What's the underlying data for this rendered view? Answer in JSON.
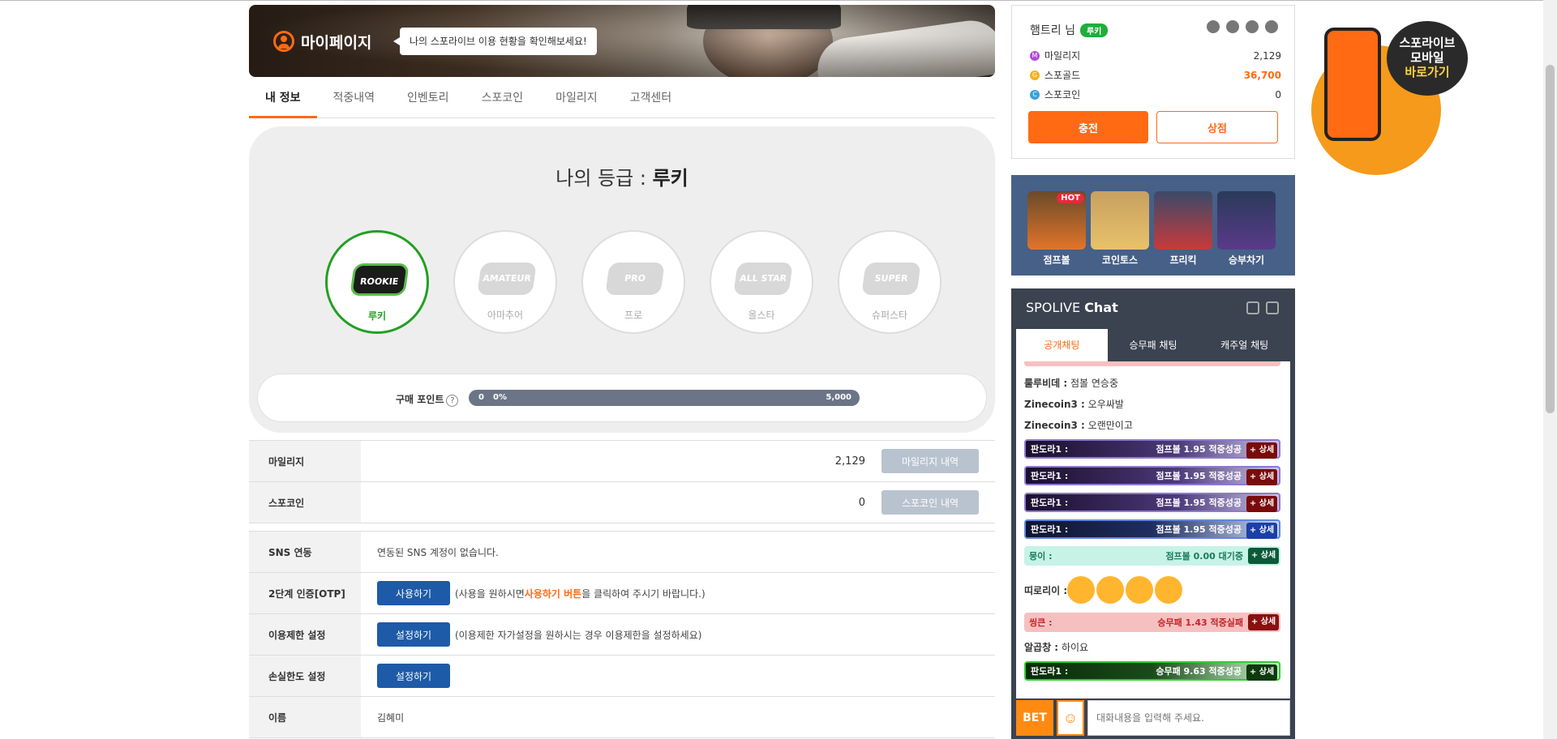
{
  "banner": {
    "title": "마이페이지",
    "bubble": "나의 스포라이브 이용 현황을 확인해보세요!"
  },
  "tabs": [
    "내 정보",
    "적중내역",
    "인벤토리",
    "스포코인",
    "마일리지",
    "고객센터"
  ],
  "grade": {
    "title_prefix": "나의 등급 : ",
    "title_value": "루키",
    "levels": [
      {
        "emblem": "ROOKIE",
        "label": "루키"
      },
      {
        "emblem": "AMATEUR",
        "label": "아마추어"
      },
      {
        "emblem": "PRO",
        "label": "프로"
      },
      {
        "emblem": "ALL STAR",
        "label": "올스타"
      },
      {
        "emblem": "SUPER STAR",
        "label": "슈퍼스타"
      }
    ],
    "points_label": "구매 포인트",
    "qmark": "?",
    "bar_min": "0",
    "bar_pct": "0%",
    "bar_max": "5,000",
    "progress": 0
  },
  "table1": [
    {
      "key": "마일리지",
      "value": "2,129",
      "button": "마일리지 내역"
    },
    {
      "key": "스포코인",
      "value": "0",
      "button": "스포코인 내역"
    }
  ],
  "table2": {
    "sns": {
      "key": "SNS 연동",
      "value": "연동된 SNS 계정이 없습니다."
    },
    "otp": {
      "key": "2단계 인증[OTP]",
      "button": "사용하기",
      "note_pre": "(사용을 원하시면 ",
      "note_hl": "사용하기 버튼",
      "note_post": "을 클릭하여 주시기 바랍니다.)"
    },
    "limit": {
      "key": "이용제한 설정",
      "button": "설정하기",
      "note": "(이용제한 자가설정을 원하시는 경우 이용제한을 설정하세요)"
    },
    "loss": {
      "key": "손실한도 설정",
      "button": "설정하기"
    },
    "name": {
      "key": "이름",
      "value": "김혜미"
    }
  },
  "user": {
    "name": "햄트리 님",
    "badge": "루키",
    "mileage_label": "마일리지",
    "mileage": "2,129",
    "gold_label": "스포골드",
    "gold": "36,700",
    "coin_label": "스포코인",
    "coin": "0",
    "charge": "충전",
    "shop": "상점"
  },
  "promo": {
    "line1": "스포라이브",
    "line2": "모바일",
    "line3": "바로가기"
  },
  "games": [
    {
      "name": "점프볼",
      "hot": "HOT"
    },
    {
      "name": "코인토스"
    },
    {
      "name": "프리킥"
    },
    {
      "name": "승부차기"
    }
  ],
  "chat": {
    "title_light": "SPOLIVE ",
    "title_bold": "Chat",
    "tabs": [
      "공개채팅",
      "승무패 채팅",
      "캐주얼 채팅"
    ],
    "messages": [
      {
        "user": "룰루비데 :",
        "text": "점볼 연승중"
      },
      {
        "user": "Zinecoin3 :",
        "text": "오우싸발"
      },
      {
        "user": "Zinecoin3 :",
        "text": "오랜만이고"
      }
    ],
    "bets": [
      {
        "user": "판도라1 :",
        "game": "점프볼 1.95",
        "result": "적중성공",
        "detail": "+ 상세"
      },
      {
        "user": "판도라1 :",
        "game": "점프볼 1.95",
        "result": "적중성공",
        "detail": "+ 상세"
      },
      {
        "user": "판도라1 :",
        "game": "점프볼 1.95",
        "result": "적중성공",
        "detail": "+ 상세"
      },
      {
        "user": "판도라1 :",
        "game": "점프볼 1.95",
        "result": "적중성공",
        "detail": "+ 상세"
      },
      {
        "user": "뭉이 :",
        "game": "점프볼 0.00",
        "result": "대기중",
        "detail": "+ 상세"
      },
      {
        "user": "씽큰 :",
        "game": "승무패 1.43",
        "result": "적중실패",
        "detail": "+ 상세"
      },
      {
        "user": "판도라1 :",
        "game": "승무패 9.63",
        "result": "적중성공",
        "detail": "+ 상세"
      }
    ],
    "emoji_user": "띠로리이 :",
    "msg_after": {
      "user": "알곱창 :",
      "text": "하이요"
    },
    "bet_button": "BET",
    "placeholder": "대화내용을 입력해 주세요."
  }
}
